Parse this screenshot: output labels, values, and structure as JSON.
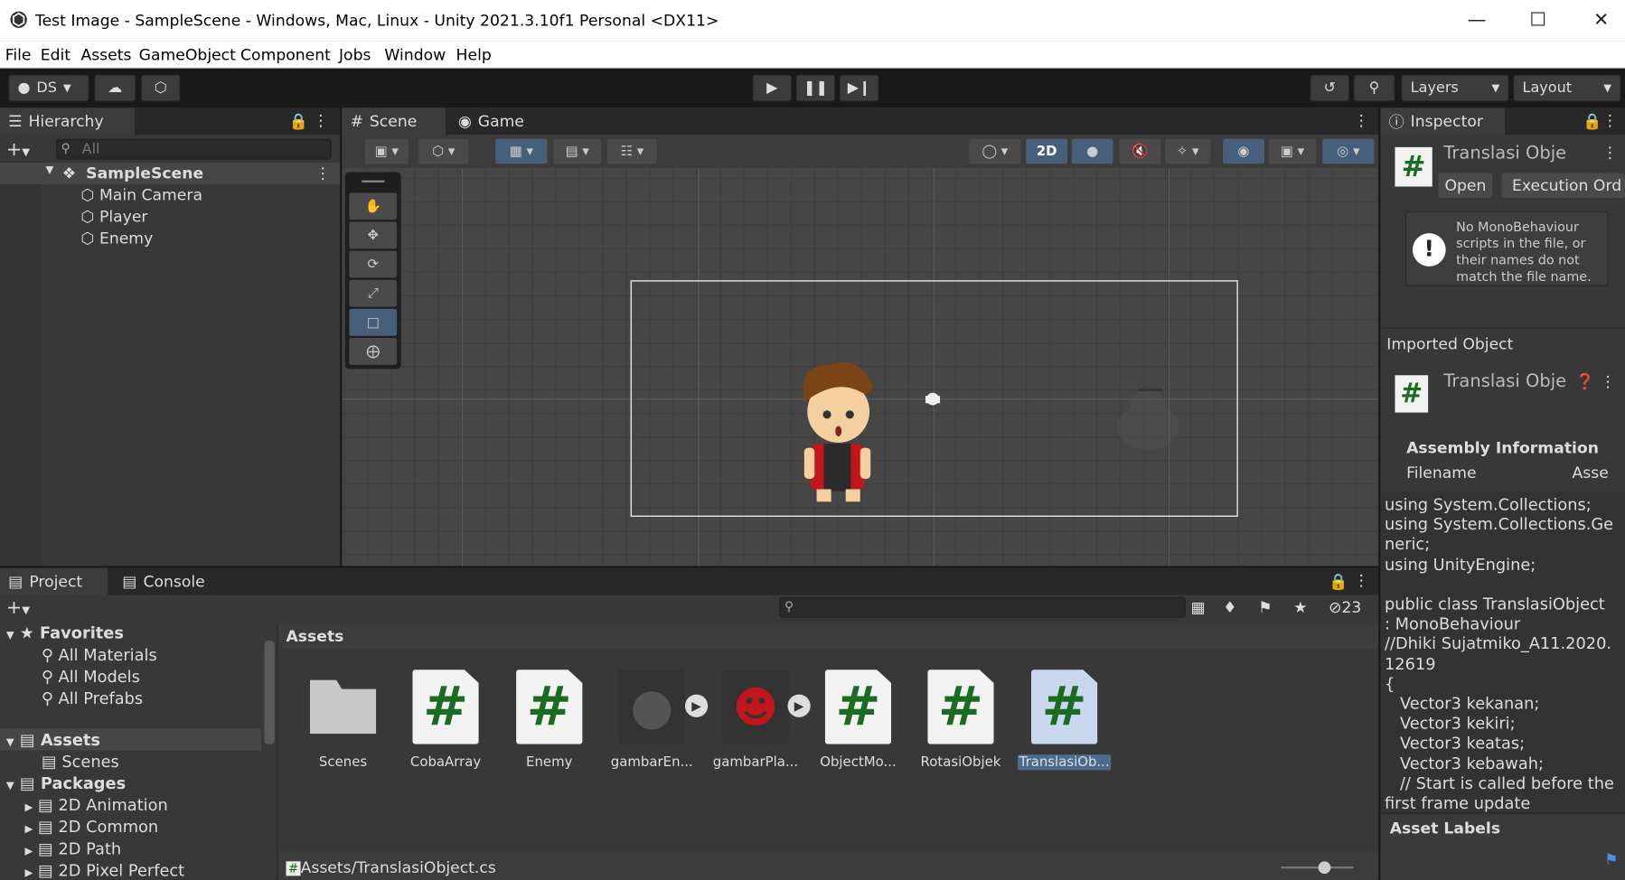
{
  "window": {
    "title": "Test Image - SampleScene - Windows, Mac, Linux - Unity 2021.3.10f1 Personal <DX11>"
  },
  "menu": [
    "File",
    "Edit",
    "Assets",
    "GameObject",
    "Component",
    "Jobs",
    "Window",
    "Help"
  ],
  "toolbar": {
    "account": "DS",
    "layers": "Layers",
    "layout": "Layout"
  },
  "hierarchy": {
    "tab": "Hierarchy",
    "search_placeholder": "All",
    "scene": "SampleScene",
    "items": [
      "Main Camera",
      "Player",
      "Enemy"
    ]
  },
  "scene_tabs": {
    "scene": "Scene",
    "game": "Game",
    "mode_2d": "2D"
  },
  "inspector": {
    "tab": "Inspector",
    "title": "Translasi Obje",
    "open": "Open",
    "execution": "Execution Ord",
    "warning": "No MonoBehaviour scripts in the file, or their names do not match the file name.",
    "imported": "Imported Object",
    "imported_title": "Translasi Obje",
    "assembly": "Assembly Information",
    "filename": "Filename",
    "filename_val": "Asse",
    "code": "using System.Collections;\nusing System.Collections.Generic;\nusing UnityEngine;\n\npublic class TranslasiObject : MonoBehaviour\n//Dhiki Sujatmiko_A11.2020.12619\n{\n   Vector3 kekanan;\n   Vector3 kekiri;\n   Vector3 keatas;\n   Vector3 kebawah;\n   // Start is called before the first frame update",
    "labels": "Asset Labels"
  },
  "project": {
    "tab_project": "Project",
    "tab_console": "Console",
    "count": "23",
    "breadcrumb": "Assets",
    "path": "Assets/TranslasiObject.cs",
    "tree": {
      "favorites": "Favorites",
      "fav_items": [
        "All Materials",
        "All Models",
        "All Prefabs"
      ],
      "assets": "Assets",
      "scenes": "Scenes",
      "packages": "Packages",
      "pkg_items": [
        "2D Animation",
        "2D Common",
        "2D Path",
        "2D Pixel Perfect"
      ]
    },
    "assets": [
      {
        "name": "Scenes"
      },
      {
        "name": "CobaArray"
      },
      {
        "name": "Enemy"
      },
      {
        "name": "gambarEn..."
      },
      {
        "name": "gambarPla..."
      },
      {
        "name": "ObjectMo..."
      },
      {
        "name": "RotasiObjek"
      },
      {
        "name": "TranslasiOb..."
      }
    ]
  }
}
